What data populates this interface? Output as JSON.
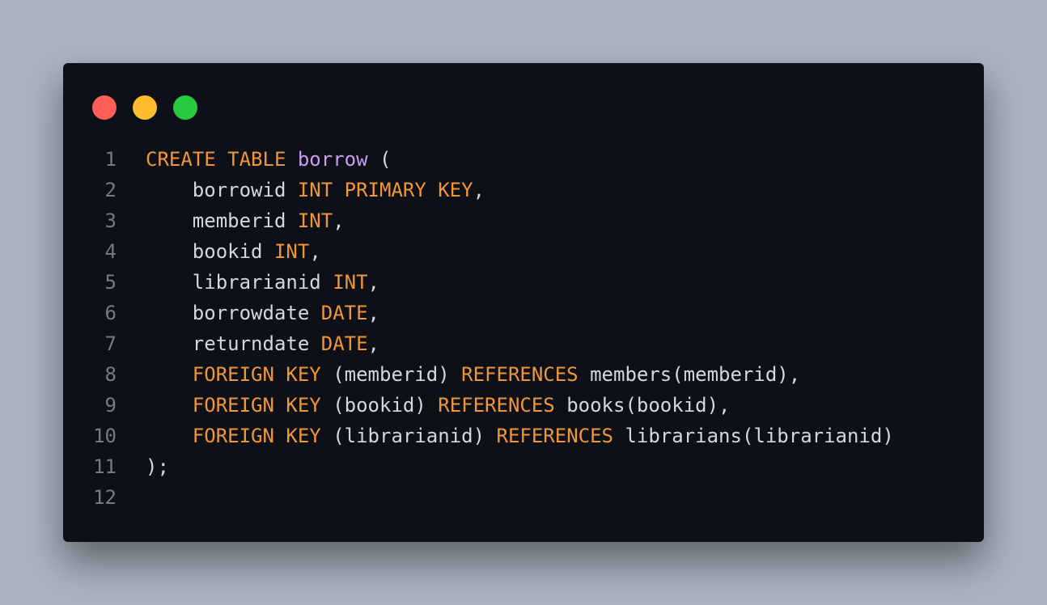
{
  "window_controls": {
    "close": "#ff5f56",
    "minimize": "#ffbd2e",
    "maximize": "#27c93f"
  },
  "code": {
    "language": "sql",
    "lines": [
      {
        "number": "1",
        "tokens": [
          {
            "t": "CREATE TABLE",
            "k": "kw"
          },
          {
            "t": " ",
            "k": "pl"
          },
          {
            "t": "borrow",
            "k": "id"
          },
          {
            "t": " (",
            "k": "pl"
          }
        ]
      },
      {
        "number": "2",
        "tokens": [
          {
            "t": "    borrowid ",
            "k": "pl"
          },
          {
            "t": "INT PRIMARY KEY",
            "k": "kw"
          },
          {
            "t": ",",
            "k": "pl"
          }
        ]
      },
      {
        "number": "3",
        "tokens": [
          {
            "t": "    memberid ",
            "k": "pl"
          },
          {
            "t": "INT",
            "k": "kw"
          },
          {
            "t": ",",
            "k": "pl"
          }
        ]
      },
      {
        "number": "4",
        "tokens": [
          {
            "t": "    bookid ",
            "k": "pl"
          },
          {
            "t": "INT",
            "k": "kw"
          },
          {
            "t": ",",
            "k": "pl"
          }
        ]
      },
      {
        "number": "5",
        "tokens": [
          {
            "t": "    librarianid ",
            "k": "pl"
          },
          {
            "t": "INT",
            "k": "kw"
          },
          {
            "t": ",",
            "k": "pl"
          }
        ]
      },
      {
        "number": "6",
        "tokens": [
          {
            "t": "    borrowdate ",
            "k": "pl"
          },
          {
            "t": "DATE",
            "k": "kw"
          },
          {
            "t": ",",
            "k": "pl"
          }
        ]
      },
      {
        "number": "7",
        "tokens": [
          {
            "t": "    returndate ",
            "k": "pl"
          },
          {
            "t": "DATE",
            "k": "kw"
          },
          {
            "t": ",",
            "k": "pl"
          }
        ]
      },
      {
        "number": "8",
        "tokens": [
          {
            "t": "    ",
            "k": "pl"
          },
          {
            "t": "FOREIGN KEY",
            "k": "kw"
          },
          {
            "t": " (memberid) ",
            "k": "pl"
          },
          {
            "t": "REFERENCES",
            "k": "kw"
          },
          {
            "t": " members(memberid),",
            "k": "pl"
          }
        ]
      },
      {
        "number": "9",
        "tokens": [
          {
            "t": "    ",
            "k": "pl"
          },
          {
            "t": "FOREIGN KEY",
            "k": "kw"
          },
          {
            "t": " (bookid) ",
            "k": "pl"
          },
          {
            "t": "REFERENCES",
            "k": "kw"
          },
          {
            "t": " books(bookid),",
            "k": "pl"
          }
        ]
      },
      {
        "number": "10",
        "tokens": [
          {
            "t": "    ",
            "k": "pl"
          },
          {
            "t": "FOREIGN KEY",
            "k": "kw"
          },
          {
            "t": " (librarianid) ",
            "k": "pl"
          },
          {
            "t": "REFERENCES",
            "k": "kw"
          },
          {
            "t": " librarians(librarianid)",
            "k": "pl"
          }
        ]
      },
      {
        "number": "11",
        "tokens": [
          {
            "t": ");",
            "k": "pl"
          }
        ]
      },
      {
        "number": "12",
        "tokens": []
      }
    ]
  }
}
